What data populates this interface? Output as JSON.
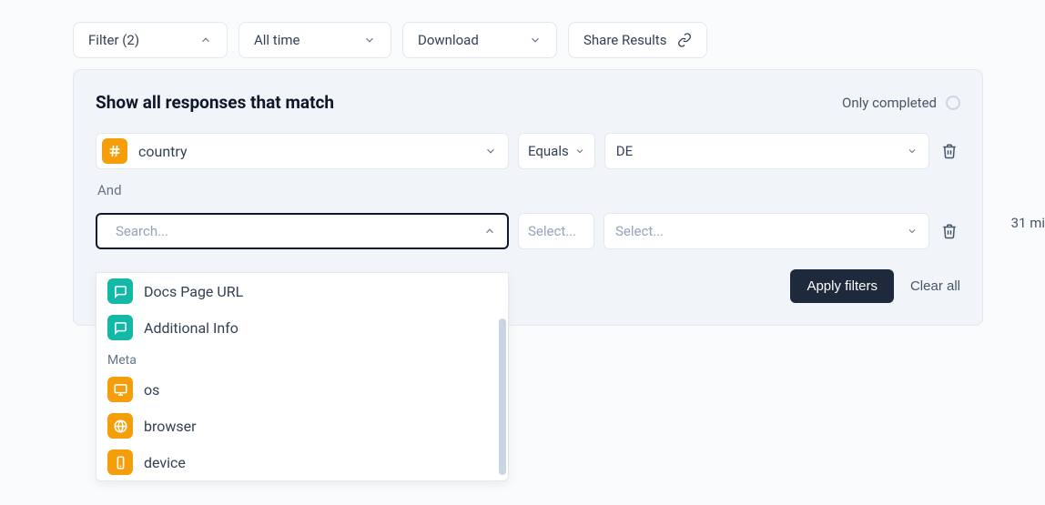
{
  "toolbar": {
    "filter_label": "Filter (2)",
    "time_label": "All time",
    "download_label": "Download",
    "share_label": "Share Results"
  },
  "panel": {
    "title": "Show all responses that match",
    "only_completed_label": "Only completed"
  },
  "rows": [
    {
      "field": "country",
      "operator": "Equals",
      "value": "DE"
    },
    {
      "field_placeholder": "Search...",
      "operator_placeholder": "Select...",
      "value_placeholder": "Select..."
    }
  ],
  "and_label": "And",
  "dropdown": {
    "items_top": [
      {
        "label": "Docs Page URL",
        "icon": "message",
        "color": "teal"
      },
      {
        "label": "Additional Info",
        "icon": "message",
        "color": "teal"
      }
    ],
    "meta_section_label": "Meta",
    "items_meta": [
      {
        "label": "os",
        "icon": "monitor",
        "color": "orange"
      },
      {
        "label": "browser",
        "icon": "globe",
        "color": "orange"
      },
      {
        "label": "device",
        "icon": "phone",
        "color": "orange"
      }
    ]
  },
  "actions": {
    "apply": "Apply filters",
    "clear": "Clear all"
  },
  "side": {
    "time_ago": "31 mi"
  }
}
